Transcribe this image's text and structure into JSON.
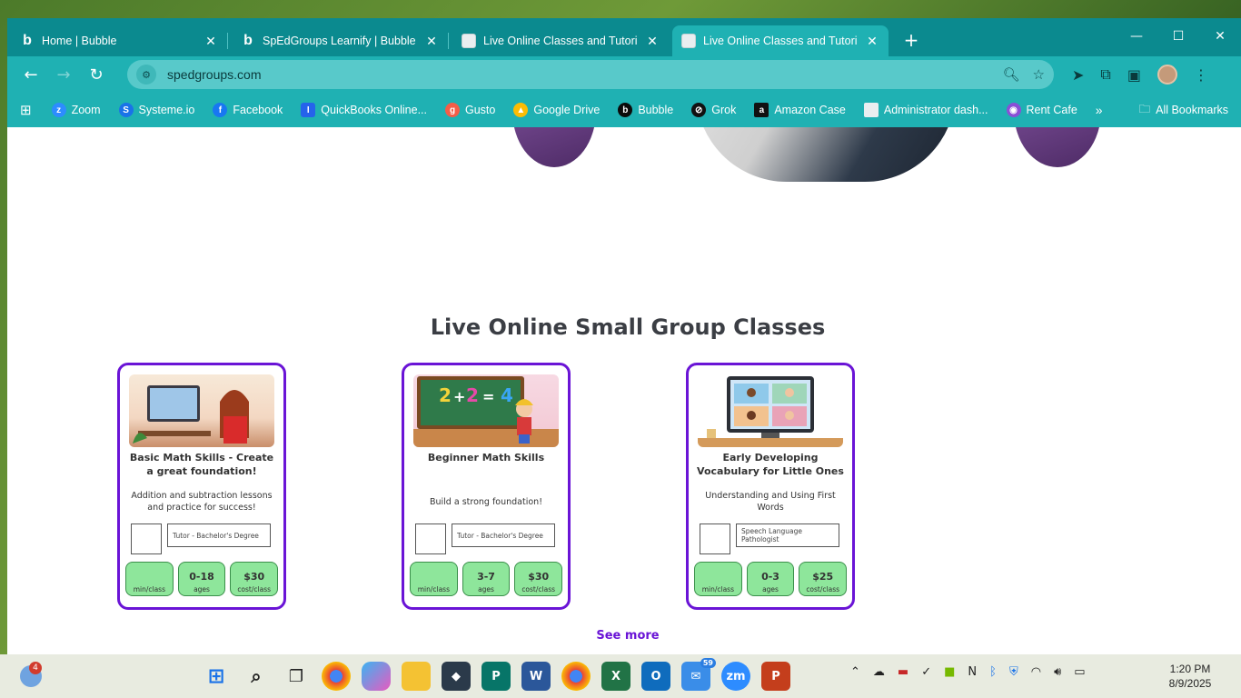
{
  "tabs": [
    {
      "title": "Home | Bubble",
      "icon": "bubble-icon",
      "active": false
    },
    {
      "title": "SpEdGroups Learnify | Bubble E",
      "icon": "bubble-icon",
      "active": false
    },
    {
      "title": "Live Online Classes and Tutoring",
      "icon": "site-icon",
      "active": false
    },
    {
      "title": "Live Online Classes and Tutoring",
      "icon": "site-icon",
      "active": true
    }
  ],
  "tab_close": "✕",
  "new_tab": "+",
  "window": {
    "minimize": "—",
    "maximize": "☐",
    "close": "✕"
  },
  "address": {
    "url": "spedgroups.com"
  },
  "bookmarks": [
    {
      "label": "Zoom",
      "icon": "zoom-icon",
      "color": "#2d8cff"
    },
    {
      "label": "Systeme.io",
      "icon": "systeme-icon",
      "color": "#1a73e8"
    },
    {
      "label": "Facebook",
      "icon": "facebook-icon",
      "color": "#1877f2"
    },
    {
      "label": "QuickBooks Online...",
      "icon": "quickbooks-icon",
      "color": "#2ca01c"
    },
    {
      "label": "Gusto",
      "icon": "gusto-icon",
      "color": "#f45d48"
    },
    {
      "label": "Google Drive",
      "icon": "google-drive-icon",
      "color": "#fbbc04"
    },
    {
      "label": "Bubble",
      "icon": "bubble-icon",
      "color": "#0b0b0b"
    },
    {
      "label": "Grok",
      "icon": "grok-icon",
      "color": "#111111"
    },
    {
      "label": "Amazon Case",
      "icon": "amazon-icon",
      "color": "#111111"
    },
    {
      "label": "Administrator dash...",
      "icon": "admin-icon",
      "color": "#e46a6a"
    },
    {
      "label": "Rent Cafe",
      "icon": "rentcafe-icon",
      "color": "#8a4fd6"
    }
  ],
  "bookmarks_more": "»",
  "all_bookmarks": "All Bookmarks",
  "section": {
    "title": "Live Online Small Group Classes"
  },
  "cards": [
    {
      "title": "Basic Math Skills - Create a great foundation!",
      "description": "Addition and subtraction lessons and practice for success!",
      "qualification": "Tutor - Bachelor's Degree",
      "stats": [
        {
          "value": "",
          "label": "min/class"
        },
        {
          "value": "0-18",
          "label": "ages"
        },
        {
          "value": "$30",
          "label": "cost/class"
        }
      ]
    },
    {
      "title": "Beginner Math Skills",
      "description": "Build a strong foundation!",
      "qualification": "Tutor - Bachelor's Degree",
      "stats": [
        {
          "value": "",
          "label": "min/class"
        },
        {
          "value": "3-7",
          "label": "ages"
        },
        {
          "value": "$30",
          "label": "cost/class"
        }
      ]
    },
    {
      "title": "Early Developing Vocabulary for Little Ones",
      "description": "Understanding and Using First Words",
      "qualification": "Speech Language Pathologist",
      "stats": [
        {
          "value": "",
          "label": "min/class"
        },
        {
          "value": "0-3",
          "label": "ages"
        },
        {
          "value": "$25",
          "label": "cost/class"
        }
      ]
    }
  ],
  "see_more": "See more",
  "taskbar": {
    "weather_badge": "4",
    "mail_badge": "59",
    "time": "1:20 PM",
    "date": "8/9/2025"
  },
  "colors": {
    "accent": "#6a14d6",
    "chrome_dark": "#0b8a8f",
    "chrome": "#1fb1b3",
    "stat_green": "#8ee69b"
  }
}
